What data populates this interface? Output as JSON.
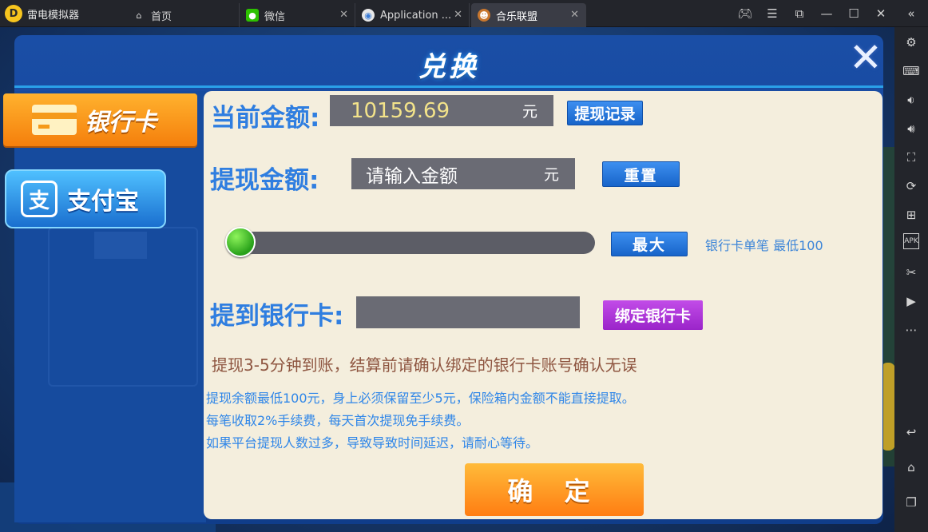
{
  "emulator": {
    "app_name": "雷电模拟器",
    "tabs": [
      {
        "label": "首页",
        "icon": "home-icon"
      },
      {
        "label": "微信",
        "icon": "wechat-icon"
      },
      {
        "label": "Application ...",
        "icon": "app-icon"
      },
      {
        "label": "合乐联盟",
        "icon": "game-icon"
      }
    ],
    "active_tab": "合乐联盟",
    "window_controls": [
      "gamepad-icon",
      "menu-icon",
      "popout-icon",
      "minimize-icon",
      "maximize-icon",
      "close-icon",
      "collapse-icon"
    ],
    "toolbar": [
      "settings-icon",
      "keyboard-icon",
      "volume-down-icon",
      "volume-up-icon",
      "fullscreen-icon",
      "rotate-icon",
      "add-window-icon",
      "apk-icon",
      "scissors-icon",
      "video-icon",
      "more-icon",
      "back-icon",
      "home-icon",
      "recent-apps-icon"
    ]
  },
  "dialog": {
    "title": "兑换",
    "side_tabs": [
      {
        "label": "银行卡",
        "selected": true
      },
      {
        "label": "支付宝",
        "selected": false
      }
    ],
    "current_amount_label": "当前金额:",
    "current_amount_value": "10159.69",
    "currency_unit": "元",
    "history_button": "提现记录",
    "withdraw_label": "提现金额:",
    "withdraw_placeholder": "请输入金额",
    "reset_button": "重置",
    "slider_value": 0,
    "max_button": "最大",
    "min_hint": "银行卡单笔 最低100",
    "to_bank_label": "提到银行卡:",
    "bank_card_value": "",
    "bind_button": "绑定银行卡",
    "arrival_notice": "提现3-5分钟到账，结算前请确认绑定的银行卡账号确认无误",
    "notes": [
      "提现余额最低100元，身上必须保留至少5元，保险箱内金额不能直接提取。",
      "每笔收取2%手续费，每天首次提现免手续费。",
      "如果平台提现人数过多，导致导致时间延迟，请耐心等待。"
    ],
    "confirm_button": "确 定"
  },
  "colors": {
    "label_blue": "#2f7ee0",
    "panel_cream": "#f4eedd",
    "orange_accent": "#ff8f1a",
    "bind_purple": "#b03ad8"
  }
}
